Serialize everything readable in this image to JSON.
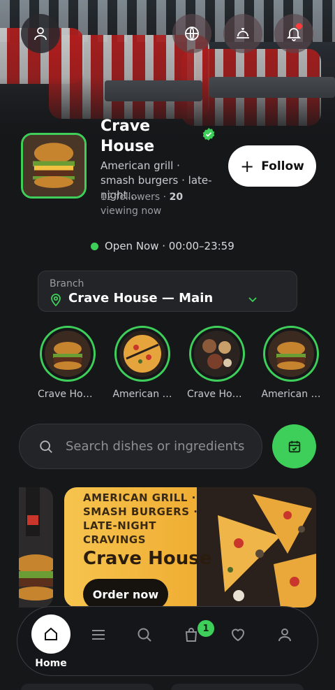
{
  "restaurant": {
    "name": "Crave House",
    "description": "American grill · smash burgers · late-night…",
    "followers": "12 followers · ",
    "viewing_count": "20",
    "viewing_suffix": " viewing now",
    "follow_label": "Follow",
    "verified_icon": "verified-check-icon"
  },
  "status": {
    "text": "Open Now · 00:00–23:59",
    "color": "#3ecf5a"
  },
  "branch": {
    "label": "Branch",
    "value": "Crave House — Main"
  },
  "stories": [
    {
      "caption": "Crave Hou…"
    },
    {
      "caption": "American …"
    },
    {
      "caption": "Crave Hou…"
    },
    {
      "caption": "American …"
    }
  ],
  "search": {
    "placeholder": "Search dishes or ingredients"
  },
  "banner": {
    "tagline": "AMERICAN GRILL · SMASH BURGERS · LATE-NIGHT CRAVINGS",
    "title": "Crave House",
    "cta": "Order now"
  },
  "nav": {
    "home_label": "Home",
    "cart_count": "1",
    "items": [
      "home-icon",
      "menu-icon",
      "search-icon",
      "bag-icon",
      "heart-icon",
      "profile-icon"
    ]
  },
  "colors": {
    "accent": "#3ecf5a",
    "background": "#161719",
    "alert": "#ff3b3b"
  }
}
